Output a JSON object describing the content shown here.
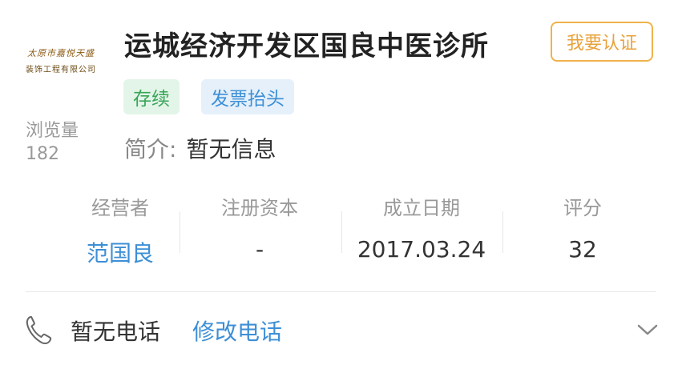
{
  "logo": {
    "line1": "太原市嘉悦天盛",
    "line2": "装饰工程有限公司"
  },
  "views": {
    "label": "浏览量",
    "count": "182"
  },
  "company": {
    "name": "运城经济开发区国良中医诊所"
  },
  "certify_button": "我要认证",
  "tags": {
    "status": "存续",
    "invoice": "发票抬头"
  },
  "intro": {
    "key": "简介:",
    "value": "暂无信息"
  },
  "stats": [
    {
      "label": "经营者",
      "value": "范国良"
    },
    {
      "label": "注册资本",
      "value": "-"
    },
    {
      "label": "成立日期",
      "value": "2017.03.24"
    },
    {
      "label": "评分",
      "value": "32"
    }
  ],
  "phone": {
    "text": "暂无电话",
    "edit_label": "修改电话",
    "icon": "phone-icon"
  },
  "colors": {
    "accent_blue": "#3d8fd6",
    "cert_orange": "#e8a23a",
    "status_green": "#3aa55a"
  }
}
